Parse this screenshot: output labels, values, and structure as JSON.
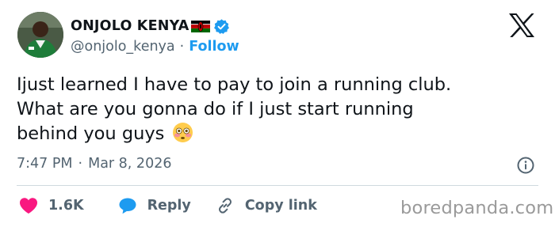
{
  "author": {
    "display_name": "ONJOLO KENYA",
    "handle": "@onjolo_kenya",
    "separator": "·",
    "follow_label": "Follow",
    "badges": [
      "kenya-flag-icon",
      "verified-badge-icon"
    ]
  },
  "tweet": {
    "lines": [
      "Ijust learned I have to pay to join a running club.",
      "What are you gonna do if I just start running",
      "behind you guys"
    ],
    "emoji": "flushed-face-emoji",
    "time": "7:47 PM",
    "separator": "·",
    "date": "Mar 8, 2026"
  },
  "actions": {
    "like_count": "1.6K",
    "reply_label": "Reply",
    "copy_label": "Copy link"
  },
  "watermark": "boredpanda.com",
  "colors": {
    "accent": "#1d9bf0",
    "like": "#f91880",
    "muted": "#536471",
    "text": "#0f1419",
    "divider": "#cfd9de"
  }
}
